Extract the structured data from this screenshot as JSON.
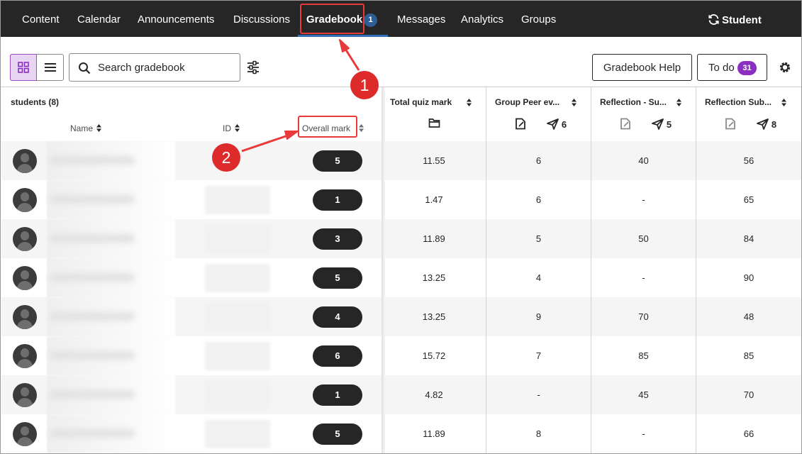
{
  "nav": {
    "tabs": [
      "Content",
      "Calendar",
      "Announcements",
      "Discussions",
      "Gradebook",
      "Messages",
      "Analytics",
      "Groups"
    ],
    "active_tab": "Gradebook",
    "gradebook_badge": "1",
    "student_preview": "Student Preview"
  },
  "toolbar": {
    "search_placeholder": "Search gradebook",
    "help_label": "Gradebook Help",
    "todo_label": "To do",
    "todo_count": "31"
  },
  "table": {
    "students_count": "students (8)",
    "col_name": "Name",
    "col_id": "ID",
    "col_overall": "Overall mark",
    "grade_columns": [
      {
        "title": "Total quiz mark",
        "submitted": ""
      },
      {
        "title": "Group Peer ev...",
        "submitted": "6"
      },
      {
        "title": "Reflection - Su...",
        "submitted": "5"
      },
      {
        "title": "Reflection Sub...",
        "submitted": "8"
      }
    ],
    "rows": [
      {
        "overall": "5",
        "c1": "11.55",
        "c2": "6",
        "c3": "40",
        "c4": "56"
      },
      {
        "overall": "1",
        "c1": "1.47",
        "c2": "6",
        "c3": "-",
        "c4": "65"
      },
      {
        "overall": "3",
        "c1": "11.89",
        "c2": "5",
        "c3": "50",
        "c4": "84"
      },
      {
        "overall": "5",
        "c1": "13.25",
        "c2": "4",
        "c3": "-",
        "c4": "90"
      },
      {
        "overall": "4",
        "c1": "13.25",
        "c2": "9",
        "c3": "70",
        "c4": "48"
      },
      {
        "overall": "6",
        "c1": "15.72",
        "c2": "7",
        "c3": "85",
        "c4": "85"
      },
      {
        "overall": "1",
        "c1": "4.82",
        "c2": "-",
        "c3": "45",
        "c4": "70"
      },
      {
        "overall": "5",
        "c1": "11.89",
        "c2": "8",
        "c3": "-",
        "c4": "66"
      }
    ]
  },
  "annotations": {
    "step1": "1",
    "step2": "2"
  },
  "colors": {
    "nav_bg": "#262626",
    "accent_purple": "#8b2fc1",
    "annotation_red": "#e83a3a",
    "tab_underline": "#2f6fb6"
  }
}
